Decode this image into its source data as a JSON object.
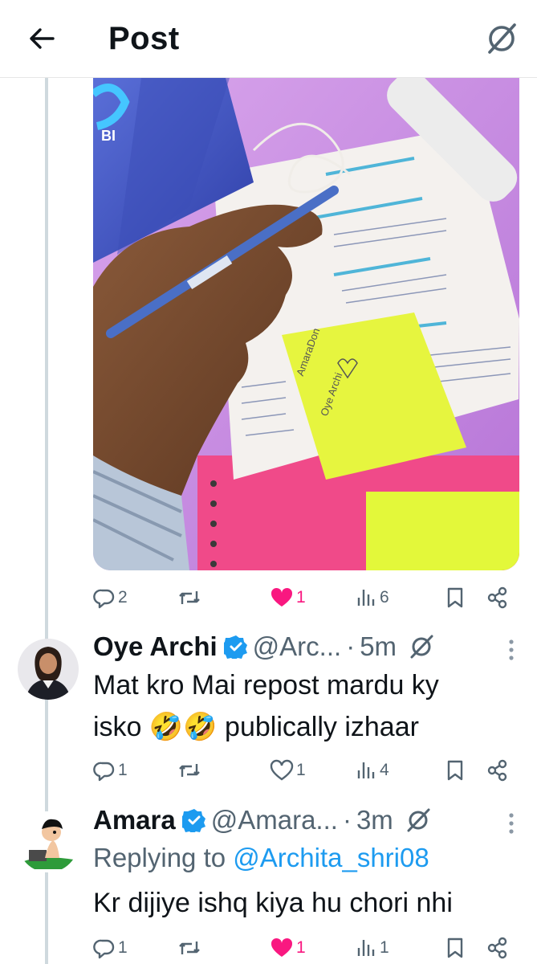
{
  "header": {
    "title": "Post"
  },
  "post": {
    "stats": {
      "replies": "2",
      "likes": "1",
      "views": "6"
    },
    "colors": {
      "like": "#f91880",
      "muted": "#536471"
    }
  },
  "replies": [
    {
      "name": "Oye Archi",
      "handle": "@Arc...",
      "dot": "·",
      "time": "5m",
      "text_line1": "Mat kro Mai repost mardu ky",
      "text_line2_a": "isko",
      "emoji": "🤣🤣",
      "text_line2_b": "publically izhaar",
      "stats": {
        "replies": "1",
        "likes": "1",
        "views": "4"
      }
    },
    {
      "name": "Amara",
      "handle": "@Amara...",
      "dot": "·",
      "time": "3m",
      "replying_prefix": "Replying to ",
      "replying_handle": "@Archita_shri08",
      "text_line1": "Kr dijiye ishq kiya hu chori nhi",
      "stats": {
        "replies": "1",
        "likes": "1",
        "views": "1"
      }
    }
  ],
  "icons": [
    "back-arrow-icon",
    "grok-icon",
    "reply-icon",
    "repost-icon",
    "heart-icon",
    "views-icon",
    "bookmark-icon",
    "share-icon",
    "verified-icon",
    "more-icon"
  ]
}
